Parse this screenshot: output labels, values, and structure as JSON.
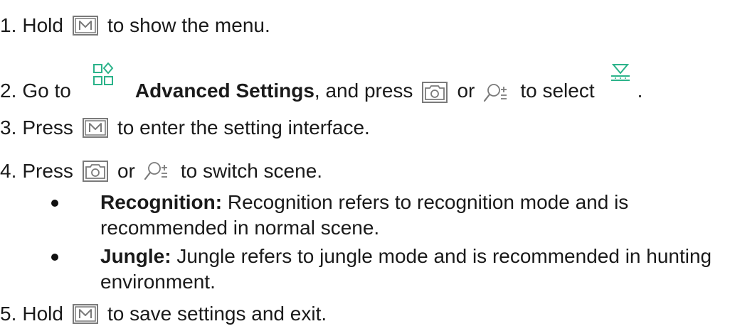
{
  "steps": {
    "step1": {
      "num": "1.",
      "pre": "Hold",
      "icon": "m-key-icon",
      "post": "to show the menu."
    },
    "step2": {
      "num": "2.",
      "pre": "Go to",
      "icon1": "advanced-settings-icon",
      "label": "Advanced Settings",
      "mid": ", and press",
      "icon2": "camera-key-icon",
      "or": "or",
      "icon3": "zoom-key-icon",
      "post": "to select",
      "icon4": "scene-icon",
      "end": "."
    },
    "step3": {
      "num": "3.",
      "pre": "Press",
      "icon": "m-key-icon",
      "post": "to enter the setting interface."
    },
    "step4": {
      "num": "4.",
      "pre": "Press",
      "icon1": "camera-key-icon",
      "or": "or",
      "icon2": "zoom-key-icon",
      "post": "to switch scene."
    },
    "bullets": [
      {
        "term": "Recognition:",
        "text": "Recognition refers to recognition mode and is recommended in normal scene."
      },
      {
        "term": "Jungle:",
        "text": "Jungle refers to jungle mode and is recommended in hunting environment."
      }
    ],
    "step5": {
      "num": "5.",
      "pre": "Hold",
      "icon": "m-key-icon",
      "post": "to save settings and exit."
    }
  },
  "colors": {
    "text": "#1a1a1a",
    "icon_gray": "#7a7a7a",
    "accent": "#2bb38a"
  }
}
